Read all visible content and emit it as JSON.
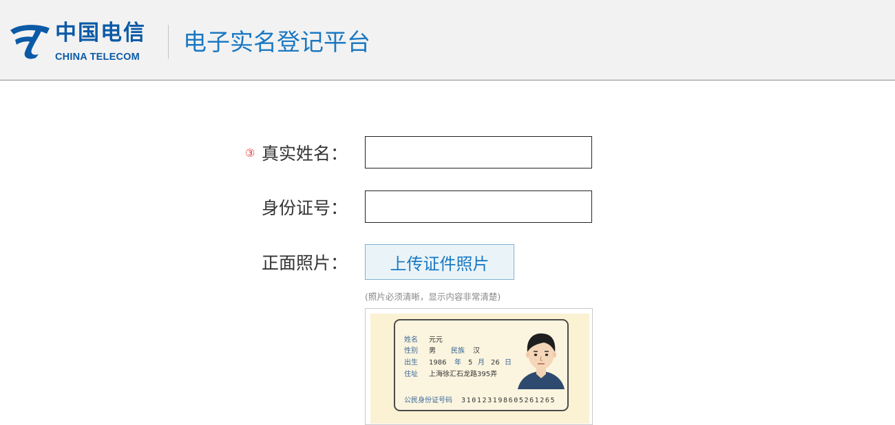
{
  "header": {
    "logo_cn": "中国电信",
    "logo_en": "CHINA TELECOM",
    "platform_title": "电子实名登记平台"
  },
  "form": {
    "required_mark": "③",
    "name_label": "真实姓名：",
    "name_value": "",
    "id_label": "身份证号：",
    "id_value": "",
    "photo_label": "正面照片：",
    "upload_button": "上传证件照片",
    "upload_hint": "(照片必须清晰，显示内容非常清楚)"
  },
  "sample_card": {
    "name_key": "姓名",
    "name_value": "元元",
    "gender_key": "性别",
    "gender_value": "男",
    "ethnicity_key": "民族",
    "ethnicity_value": "汉",
    "birth_key": "出生",
    "birth_year": "1986",
    "year_char": "年",
    "birth_month": "5",
    "month_char": "月",
    "birth_day": "26",
    "day_char": "日",
    "address_key": "住址",
    "address_value": "上海徐汇石龙路395弄",
    "number_key": "公民身份证号码",
    "number_value": "310123198605261265"
  },
  "colors": {
    "brand_blue": "#0b5aa6",
    "title_blue": "#1a78c2",
    "required_red": "#e83a3a",
    "header_bg": "#f2f2f2"
  },
  "icons": {
    "logo": "china-telecom-logo-icon",
    "portrait": "id-portrait-icon"
  }
}
